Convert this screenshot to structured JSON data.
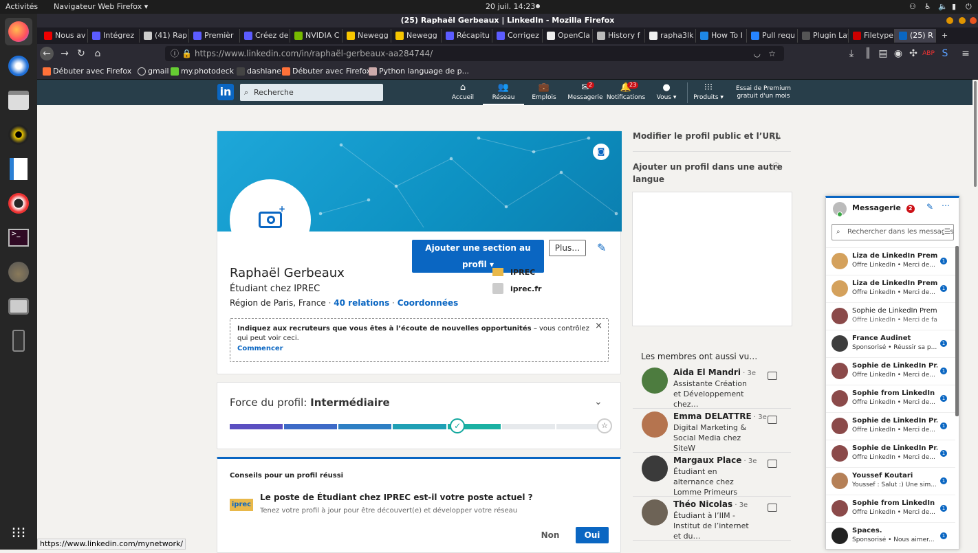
{
  "gnome": {
    "activities": "Activités",
    "app_menu": "Navigateur Web Firefox ▾",
    "clock": "20 juil.  14:23",
    "status_icons": [
      "network-icon",
      "accessibility-icon",
      "bluetooth-icon",
      "volume-icon",
      "battery-icon",
      "power-icon"
    ]
  },
  "window": {
    "title": "(25) Raphaël Gerbeaux | LinkedIn - Mozilla Firefox"
  },
  "tabs": [
    {
      "label": "Nous av",
      "color": "#e00"
    },
    {
      "label": "Intégrez",
      "color": "#5c5cff"
    },
    {
      "label": "(41) Rap",
      "color": "#ccc"
    },
    {
      "label": "Premièr",
      "color": "#5c5cff"
    },
    {
      "label": "Créez de",
      "color": "#5c5cff"
    },
    {
      "label": "NVIDIA C",
      "color": "#76b900"
    },
    {
      "label": "Newegg",
      "color": "#f7c600"
    },
    {
      "label": "Newegg",
      "color": "#f7c600"
    },
    {
      "label": "Récapitu",
      "color": "#5c5cff"
    },
    {
      "label": "Corrigez",
      "color": "#5c5cff"
    },
    {
      "label": "OpenCla",
      "color": "#eee"
    },
    {
      "label": "History f",
      "color": "#bbb"
    },
    {
      "label": "rapha3lk",
      "color": "#eee"
    },
    {
      "label": "How To I",
      "color": "#1e88e5"
    },
    {
      "label": "Pull requ",
      "color": "#2684ff"
    },
    {
      "label": "Plugin Layo",
      "color": "#555"
    },
    {
      "label": "Filetype",
      "color": "#c00"
    },
    {
      "label": "(25) R",
      "color": "#0a66c2"
    }
  ],
  "url": "https://www.linkedin.com/in/raphaël-gerbeaux-aa284744/",
  "bookmarks": [
    "Débuter avec Firefox",
    "gmail",
    "my.photodeck",
    "dashlane",
    "Débuter avec Firefox",
    "Python language de p..."
  ],
  "linkedin": {
    "search_placeholder": "Recherche",
    "nav": [
      {
        "label": "Accueil",
        "icon": "home-icon"
      },
      {
        "label": "Réseau",
        "icon": "network-people-icon"
      },
      {
        "label": "Emplois",
        "icon": "briefcase-icon"
      },
      {
        "label": "Messagerie",
        "icon": "message-icon",
        "badge": "2"
      },
      {
        "label": "Notifications",
        "icon": "bell-icon",
        "badge": "23"
      },
      {
        "label": "Vous ▾",
        "icon": "avatar-icon"
      },
      {
        "label": "Produits ▾",
        "icon": "grid-icon"
      }
    ],
    "premium_line1": "Essai de Premium",
    "premium_line2": "gratuit d'un mois"
  },
  "profile": {
    "add_section": "Ajouter une section au profil ▾",
    "more": "Plus…",
    "name": "Raphaël Gerbeaux",
    "headline": "Étudiant chez IPREC",
    "location": "Région de Paris, France",
    "relations": "40 relations",
    "contact": "Coordonnées",
    "company": "IPREC",
    "website": "iprec.fr",
    "opportunity_bold": "Indiquez aux recruteurs que vous êtes à l’écoute de nouvelles opportunités",
    "opportunity_rest": " – vous contrôlez qui peut voir ceci.",
    "opportunity_cta": "Commencer"
  },
  "strength": {
    "label": "Force du profil: ",
    "level": "Intermédiaire",
    "progress": 0.6
  },
  "tips": {
    "title": "Conseils pour un profil réussi",
    "question": "Le poste de Étudiant chez IPREC est-il votre poste actuel ?",
    "subtitle": "Tenez votre profil à jour pour être découvert(e) et développer votre réseau",
    "no": "Non",
    "yes": "Oui",
    "logo_text": "iprec"
  },
  "sidebar": {
    "edit_public": "Modifier le profil public et l’URL",
    "add_language_1": "Ajouter un profil dans une autre",
    "add_language_2": "langue",
    "also_viewed": "Les membres ont aussi vu…",
    "people": [
      {
        "name": "Aida El Mandri",
        "degree": " · 3e",
        "headline": "Assistante Création et Développement chez…"
      },
      {
        "name": "Emma DELATTRE",
        "degree": " · 3e",
        "headline": "Digital Marketing & Social Media chez SiteW"
      },
      {
        "name": "Margaux Place",
        "degree": " · 3e",
        "headline": "Étudiant en alternance chez Lomme Primeurs"
      },
      {
        "name": "Théo Nicolas",
        "degree": " · 3e",
        "headline": "Étudiant à l’IIM - Institut de l’internet et du…"
      }
    ]
  },
  "messaging": {
    "title": "Messagerie",
    "badge": "2",
    "search_placeholder": "Rechercher dans les messages",
    "rows": [
      {
        "name": "Liza de LinkedIn Prem...",
        "snippet": "Offre LinkedIn •  Merci de...",
        "bold": true
      },
      {
        "name": "Liza de LinkedIn Prem...",
        "snippet": "Offre LinkedIn •  Merci de...",
        "bold": true
      },
      {
        "name": "Sophie de LinkedIn Premi...",
        "snippet": "Offre LinkedIn •  Merci de fair...",
        "bold": false
      },
      {
        "name": "France Audinet",
        "snippet": "Sponsorisé •  Réussir sa p...",
        "bold": true
      },
      {
        "name": "Sophie de LinkedIn Pr...",
        "snippet": "Offre LinkedIn •  Merci de...",
        "bold": true
      },
      {
        "name": "Sophie from LinkedIn ...",
        "snippet": "Offre LinkedIn •  Merci de...",
        "bold": true
      },
      {
        "name": "Sophie de LinkedIn Pr...",
        "snippet": "Offre LinkedIn •  Merci de...",
        "bold": true
      },
      {
        "name": "Sophie de LinkedIn Pr...",
        "snippet": "Offre LinkedIn •  Merci de...",
        "bold": true
      },
      {
        "name": "Youssef Koutari",
        "snippet": "Youssef : Salut :) Une sim...",
        "bold": true
      },
      {
        "name": "Sophie from LinkedIn ...",
        "snippet": "Offre LinkedIn •  Merci de...",
        "bold": true
      },
      {
        "name": "Spaces.",
        "snippet": "Sponsorisé •  Nous aimer...",
        "bold": true
      }
    ]
  },
  "status_url": "https://www.linkedin.com/mynetwork/"
}
